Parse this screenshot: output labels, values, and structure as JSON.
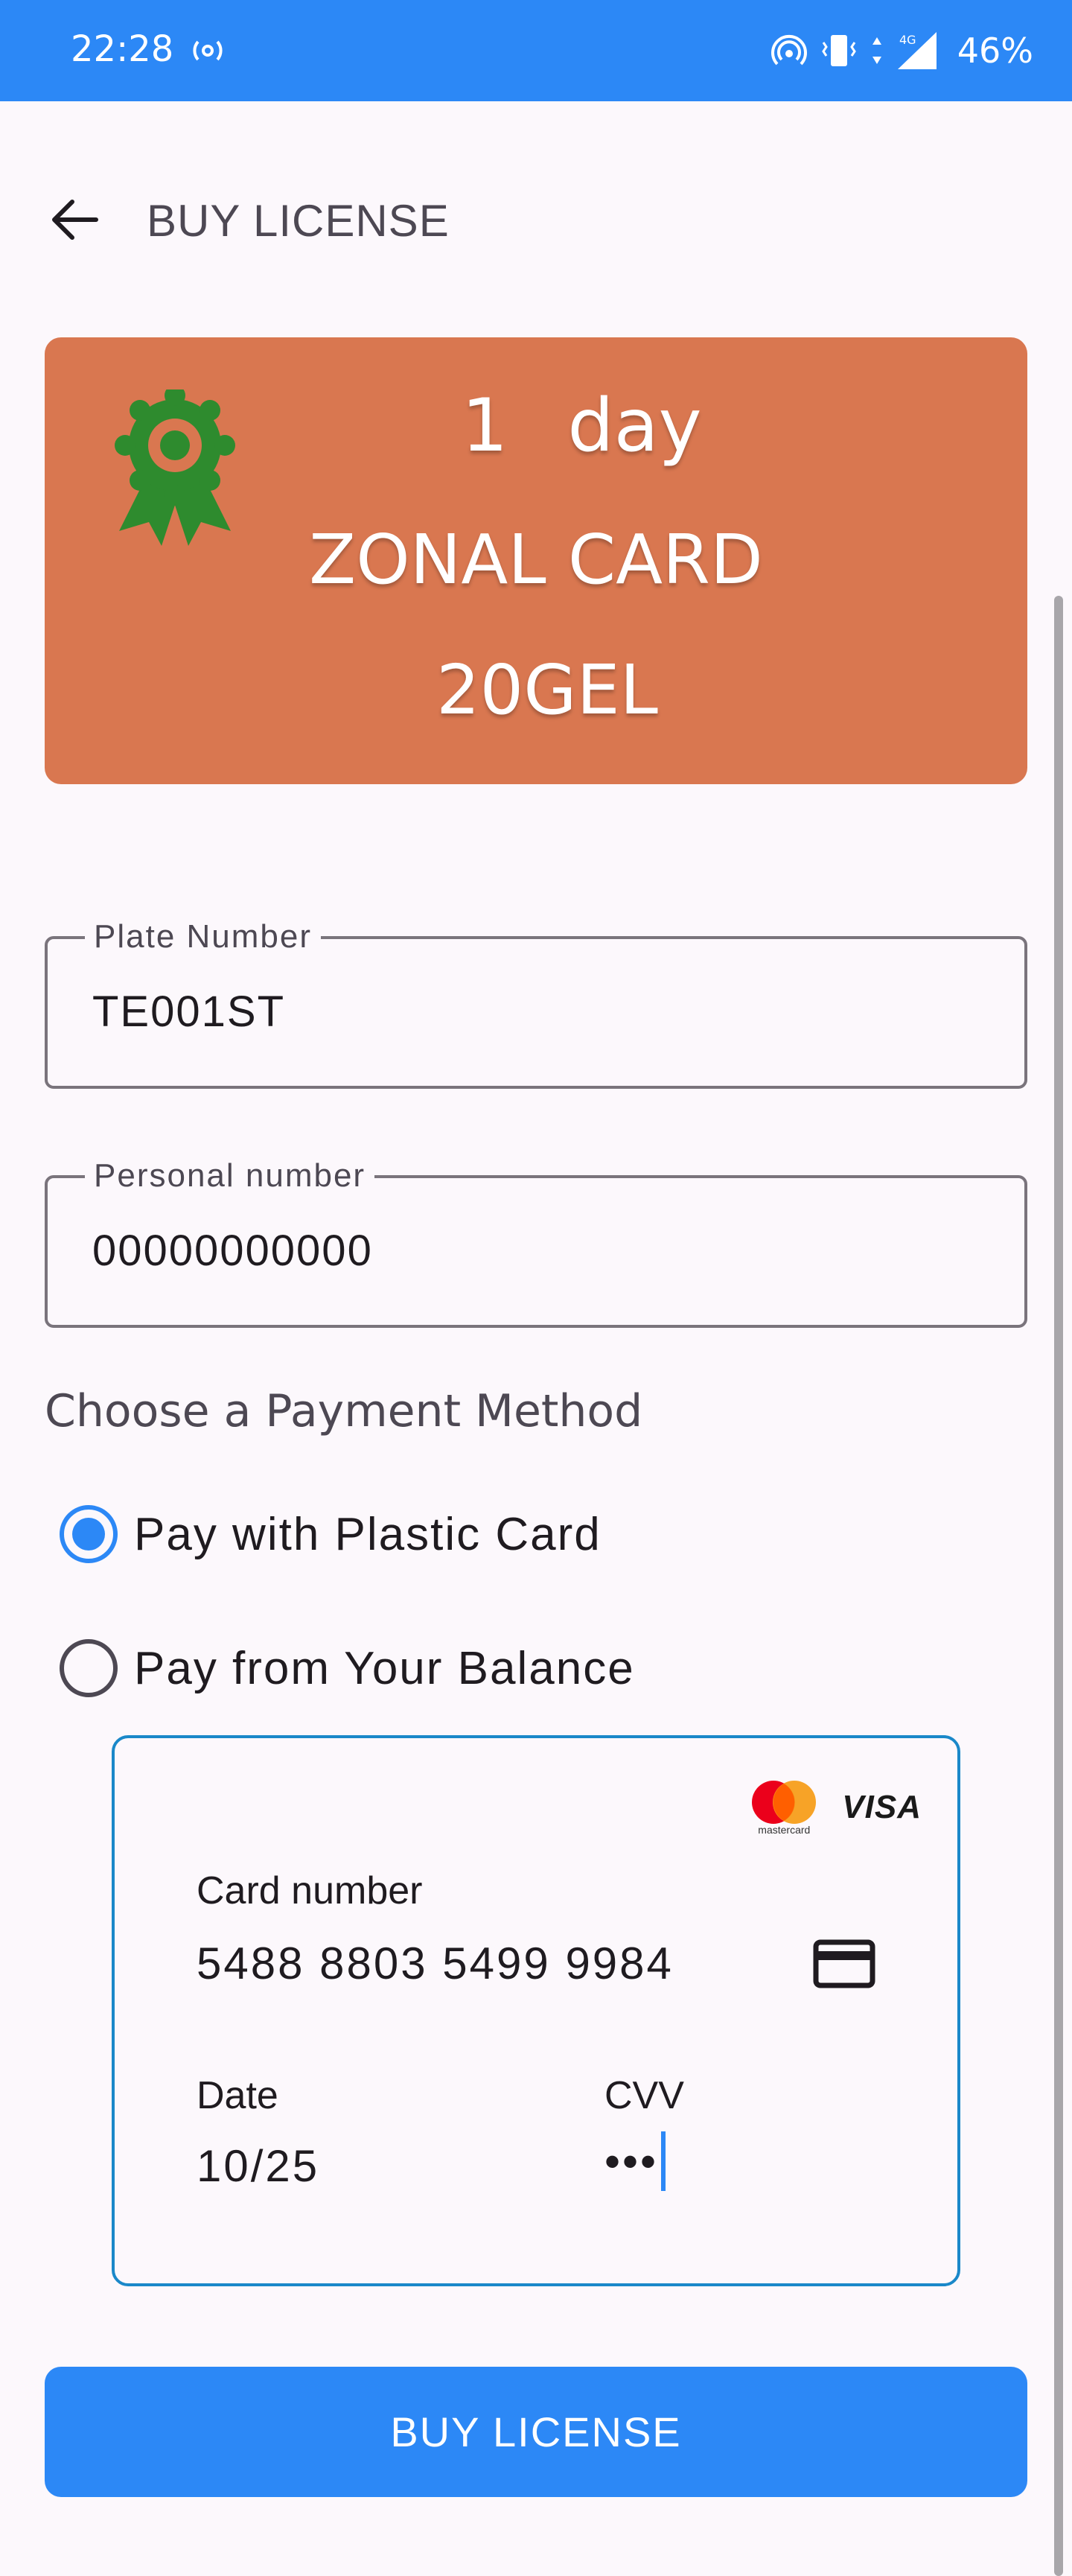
{
  "status_bar": {
    "time": "22:28",
    "battery": "46%",
    "network": "4G",
    "icons": [
      "hotspot-icon",
      "vibrate-icon",
      "data-arrows-icon",
      "signal-icon"
    ]
  },
  "header": {
    "title": "BUY LICENSE",
    "back_icon": "arrow-left-icon"
  },
  "license": {
    "duration_value": "1",
    "duration_unit": "day",
    "name": "ZONAL CARD",
    "price": "20GEL",
    "badge_icon": "award-ribbon-icon",
    "background_color": "#d97750",
    "badge_color": "#2e8b2e"
  },
  "form": {
    "plate_number": {
      "label": "Plate Number",
      "value": "TE001ST"
    },
    "personal_number": {
      "label": "Personal number",
      "value": "00000000000"
    }
  },
  "payment": {
    "title": "Choose a Payment Method",
    "options": [
      {
        "label": "Pay with Plastic Card",
        "checked": true
      },
      {
        "label": "Pay from Your Balance",
        "checked": false
      }
    ]
  },
  "card_form": {
    "brands": {
      "mastercard_text": "mastercard",
      "visa_text": "VISA"
    },
    "card_number_label": "Card number",
    "card_number_value": "5488 8803 5499 9984",
    "date_label": "Date",
    "date_value": "10/25",
    "cvv_label": "CVV",
    "cvv_value": "•••",
    "card_icon": "credit-card-icon"
  },
  "actions": {
    "buy_label": "BUY LICENSE"
  },
  "colors": {
    "accent": "#2c88f6",
    "card_border": "#1a88c9"
  }
}
